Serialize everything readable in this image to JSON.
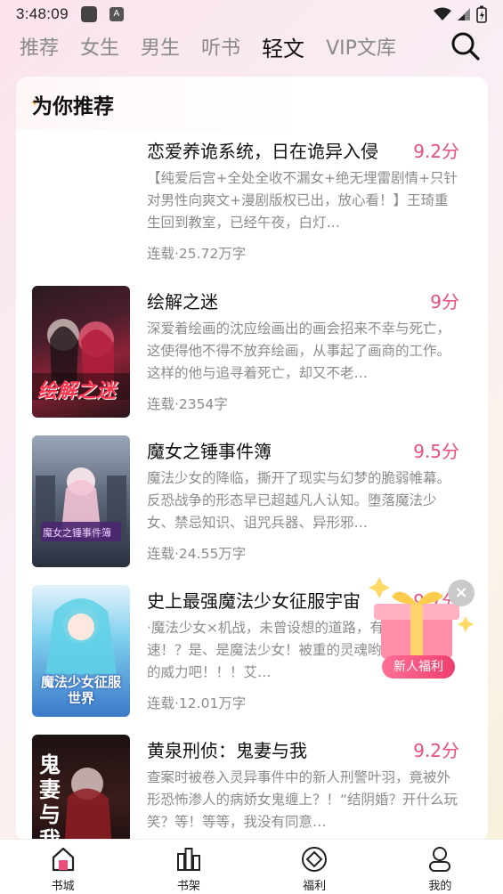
{
  "status_bar": {
    "time": "3:48:09",
    "notif_letter": "A"
  },
  "top_nav": {
    "tabs": [
      {
        "label": "推荐",
        "active": false
      },
      {
        "label": "女生",
        "active": false
      },
      {
        "label": "男生",
        "active": false
      },
      {
        "label": "听书",
        "active": false
      },
      {
        "label": "轻文",
        "active": true
      },
      {
        "label": "VIP文库",
        "active": false
      }
    ],
    "search_icon": "search-icon"
  },
  "section": {
    "title": "为你推荐"
  },
  "books": [
    {
      "title": "恋爱养诡系统，日在诡异入侵",
      "score": "9.2分",
      "desc": "【纯爱后宫+全处全收不漏女+绝无埋雷剧情+只针对男性向爽文+漫剧版权已出，放心看！】王琦重生回到教室，已经午夜，白灯…",
      "meta": "连载·25.72万字",
      "has_cover": false
    },
    {
      "title": "绘解之迷",
      "score": "9分",
      "desc": "深爱着绘画的沈应绘画出的画会招来不幸与死亡，这使得他不得不放弃绘画，从事起了画商的工作。这样的他与追寻着死亡，却又不老…",
      "meta": "连载·2354字",
      "has_cover": true,
      "cover_text": "绘解之迷"
    },
    {
      "title": "魔女之锤事件簿",
      "score": "9.5分",
      "desc": "魔法少女的降临，撕开了现实与幻梦的脆弱帷幕。反恐战争的形态早已超越凡人认知。堕落魔法少女、禁忌知识、诅咒兵器、异形邪…",
      "meta": "连载·24.55万字",
      "has_cover": true,
      "cover_text": "魔女之锤事件簿"
    },
    {
      "title": "史上最强魔法少女征服宇宙",
      "score": "9.7分",
      "desc": "·魔法少女×机战，未曾设想的道路，有角三倍速！？是、是魔法少女！被重的灵魂哟，感受魔法的威力吧！！！艾…",
      "meta": "连载·12.01万字",
      "has_cover": true,
      "cover_text": "魔法少女征服世界"
    },
    {
      "title": "黄泉刑侦：鬼妻与我",
      "score": "9.2分",
      "desc": "查案时被卷入灵异事件中的新人刑警叶羽，竟被外形恐怖渗人的病娇女鬼缠上？！“结阴婚？开什么玩笑？等！等等，我没有同意…",
      "meta": "",
      "has_cover": true,
      "cover_text": "鬼妻与我"
    }
  ],
  "promo": {
    "label": "新人福利",
    "close": "×"
  },
  "bottom_nav": [
    {
      "label": "书城",
      "icon": "home-icon"
    },
    {
      "label": "书架",
      "icon": "bookshelf-icon"
    },
    {
      "label": "福利",
      "icon": "diamond-icon"
    },
    {
      "label": "我的",
      "icon": "profile-icon"
    }
  ],
  "colors": {
    "accent": "#e8507a",
    "text_muted": "#8c8c8c"
  }
}
